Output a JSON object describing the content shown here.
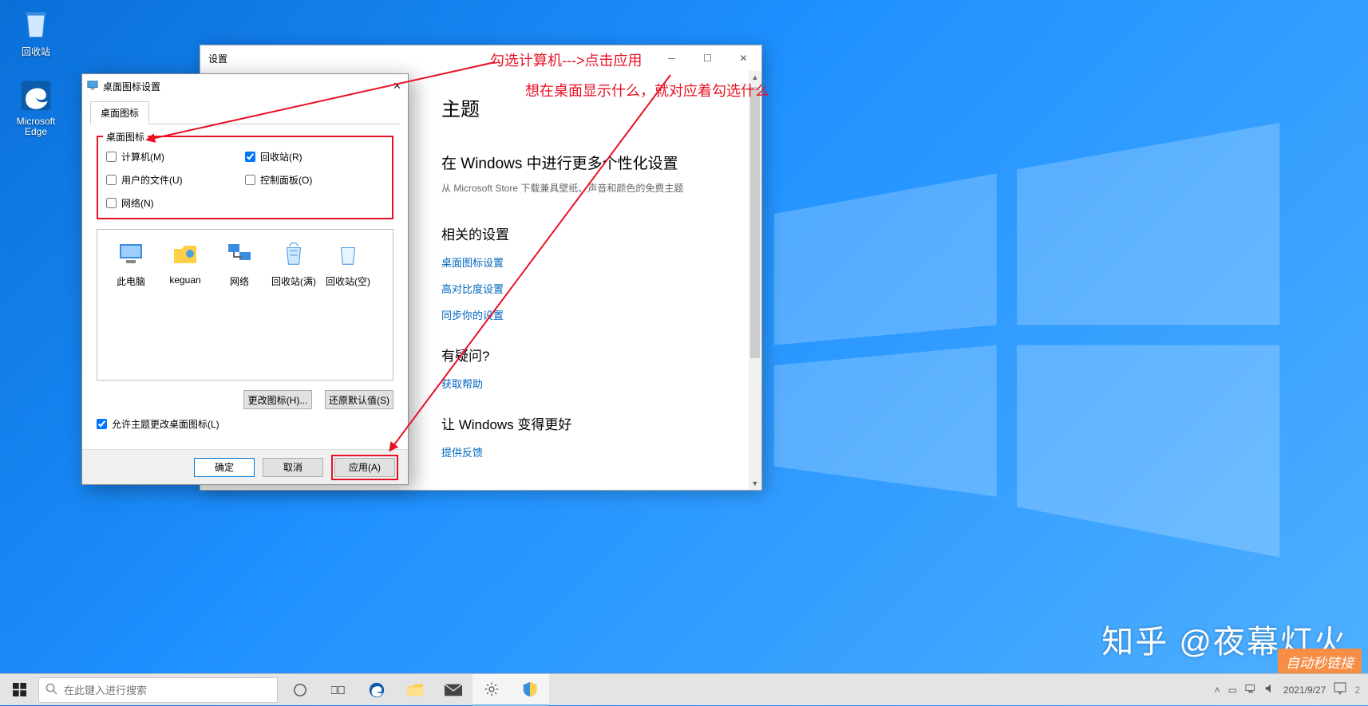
{
  "desktop": {
    "icons": [
      {
        "name": "recycle-bin",
        "label": "回收站"
      },
      {
        "name": "edge",
        "label": "Microsoft Edge"
      }
    ]
  },
  "settings_window": {
    "title": "设置",
    "page_heading": "主题",
    "more_heading": "在 Windows 中进行更多个性化设置",
    "more_sub": "从 Microsoft Store 下载兼具壁纸、声音和颜色的免费主题",
    "related_heading": "相关的设置",
    "links": {
      "desktop_icon": "桌面图标设置",
      "high_contrast": "高对比度设置",
      "sync": "同步你的设置"
    },
    "question_heading": "有疑问?",
    "help_link": "获取帮助",
    "better_heading": "让 Windows 变得更好",
    "feedback_link": "提供反馈"
  },
  "dialog": {
    "title": "桌面图标设置",
    "tab": "桌面图标",
    "group_legend": "桌面图标",
    "checks": {
      "computer": "计算机(M)",
      "userfiles": "用户的文件(U)",
      "network": "网络(N)",
      "recycle": "回收站(R)",
      "control": "控制面板(O)"
    },
    "preview": [
      "此电脑",
      "keguan",
      "网络",
      "回收站(满)",
      "回收站(空)"
    ],
    "change_icon": "更改图标(H)...",
    "restore_default": "还原默认值(S)",
    "allow_theme": "允许主题更改桌面图标(L)",
    "ok": "确定",
    "cancel": "取消",
    "apply": "应用(A)"
  },
  "annotations": {
    "line1": "勾选计算机--->点击应用",
    "line2": "想在桌面显示什么，就对应着勾选什么"
  },
  "watermark": {
    "zhihu": "知乎 @夜幕灯火",
    "corner": "自动秒链接"
  },
  "taskbar": {
    "search_placeholder": "在此键入进行搜索",
    "time": "2021/9/27",
    "tray_num": "2"
  }
}
